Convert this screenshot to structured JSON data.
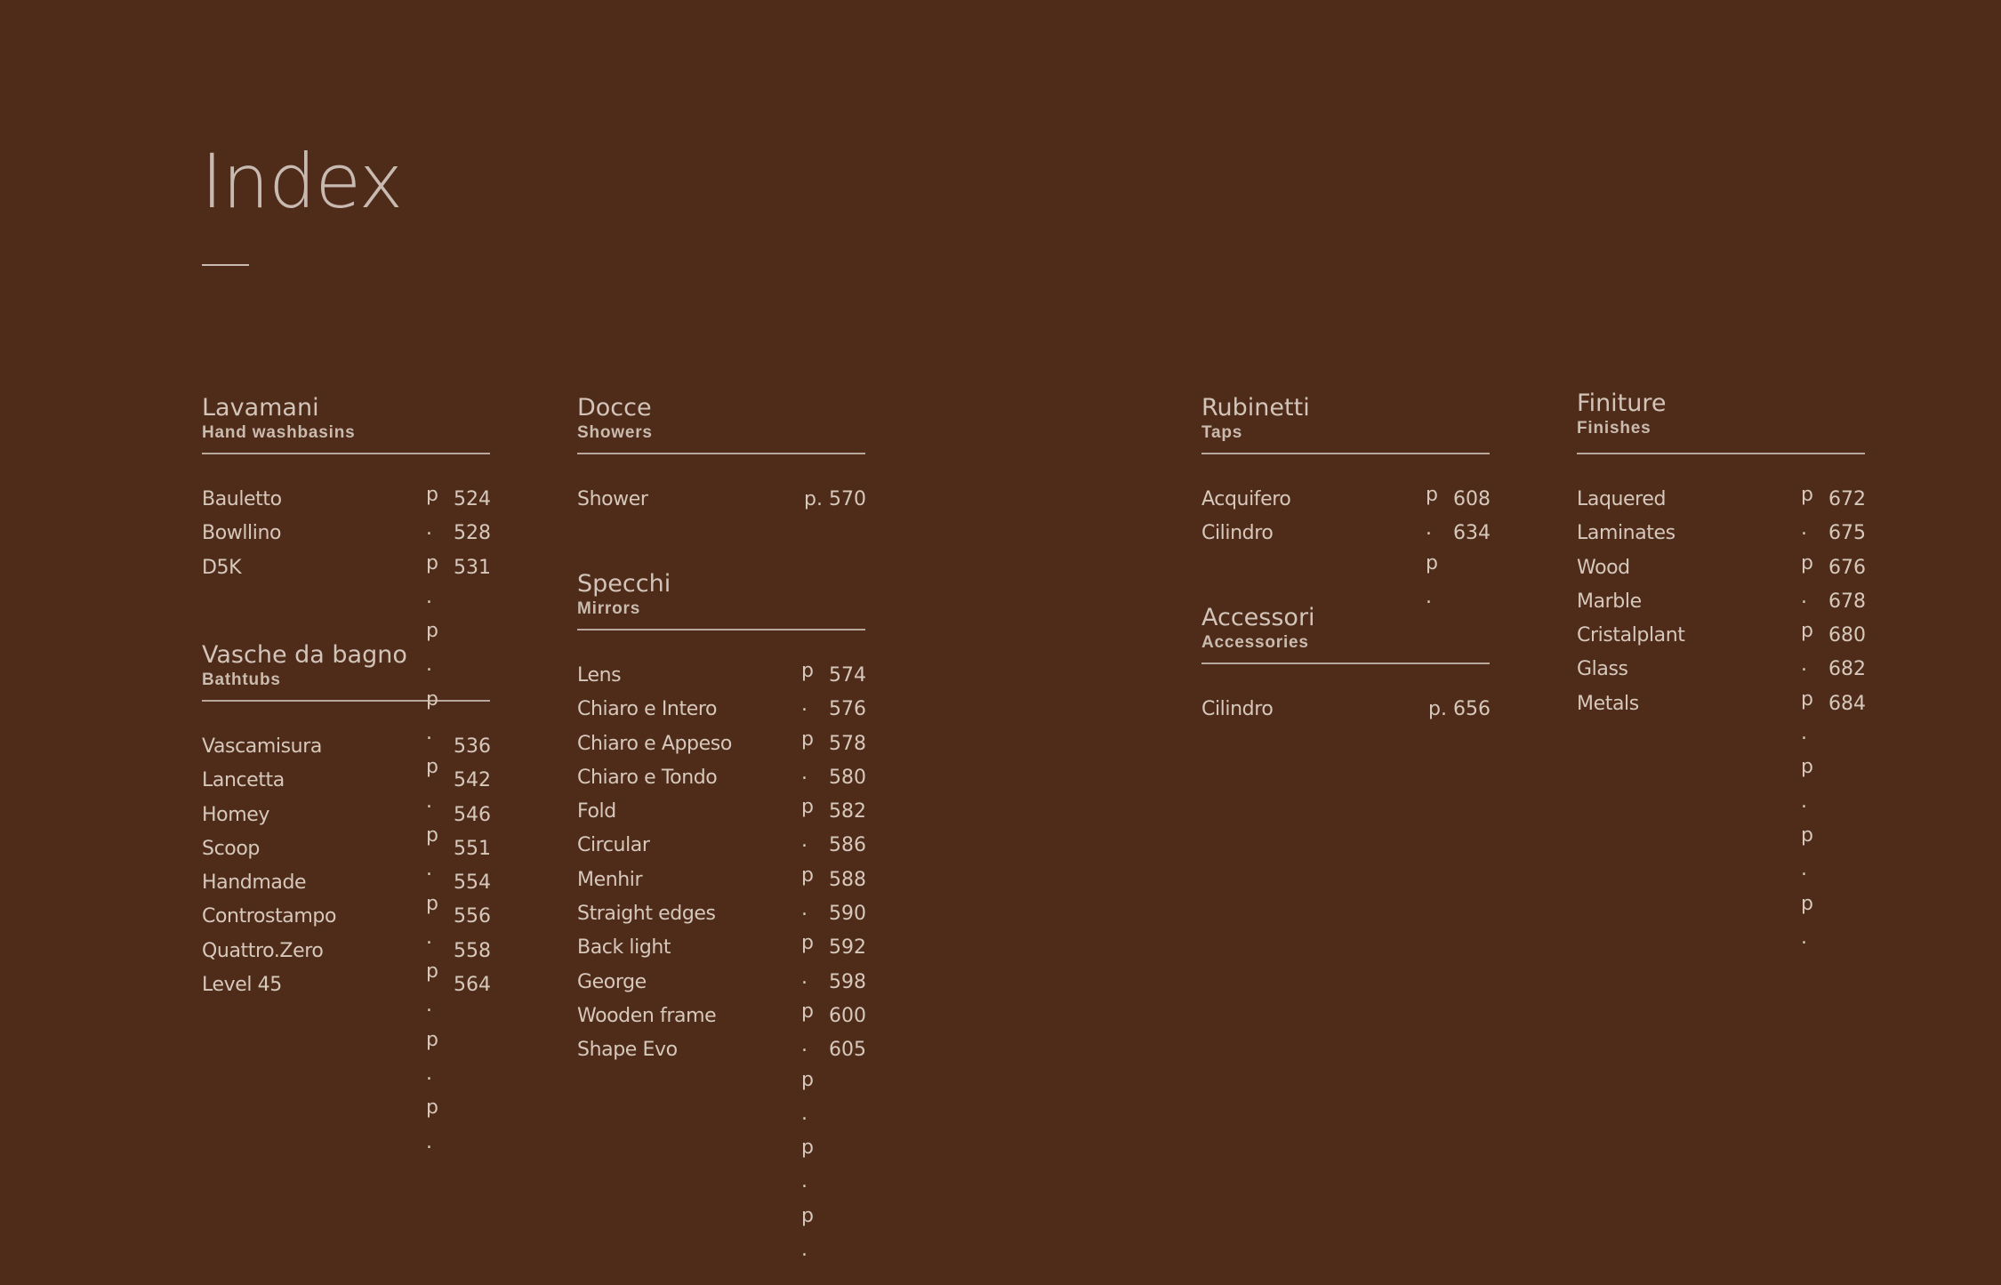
{
  "page": {
    "title": "Index",
    "p_marker": "p",
    "dot_marker": "."
  },
  "sections": {
    "lavamani": {
      "name": "Lavamani",
      "sub": "Hand washbasins",
      "entries": [
        {
          "label": "Bauletto",
          "page": "524"
        },
        {
          "label": "Bowllino",
          "page": "528"
        },
        {
          "label": "D5K",
          "page": "531"
        }
      ]
    },
    "vasche": {
      "name": "Vasche da bagno",
      "sub": "Bathtubs",
      "entries": [
        {
          "label": "Vascamisura",
          "page": "536"
        },
        {
          "label": "Lancetta",
          "page": "542"
        },
        {
          "label": "Homey",
          "page": "546"
        },
        {
          "label": "Scoop",
          "page": "551"
        },
        {
          "label": "Handmade",
          "page": "554"
        },
        {
          "label": "Controstampo",
          "page": "556"
        },
        {
          "label": "Quattro.Zero",
          "page": "558"
        },
        {
          "label": "Level 45",
          "page": "564"
        }
      ]
    },
    "docce": {
      "name": "Docce",
      "sub": "Showers",
      "entries": [
        {
          "label": "Shower",
          "page": "p.   570"
        }
      ]
    },
    "specchi": {
      "name": "Specchi",
      "sub": "Mirrors",
      "entries": [
        {
          "label": "Lens",
          "page": "574"
        },
        {
          "label": "Chiaro e Intero",
          "page": "576"
        },
        {
          "label": "Chiaro e Appeso",
          "page": "578"
        },
        {
          "label": "Chiaro e Tondo",
          "page": "580"
        },
        {
          "label": "Fold",
          "page": "582"
        },
        {
          "label": "Circular",
          "page": "586"
        },
        {
          "label": "Menhir",
          "page": "588"
        },
        {
          "label": "Straight edges",
          "page": "590"
        },
        {
          "label": "Back light",
          "page": "592"
        },
        {
          "label": "George",
          "page": "598"
        },
        {
          "label": "Wooden frame",
          "page": "600"
        },
        {
          "label": "Shape Evo",
          "page": "605"
        }
      ]
    },
    "rubinetti": {
      "name": "Rubinetti",
      "sub": "Taps",
      "entries": [
        {
          "label": "Acquifero",
          "page": "608"
        },
        {
          "label": "Cilindro",
          "page": "634"
        }
      ]
    },
    "accessori": {
      "name": "Accessori",
      "sub": "Accessories",
      "entries": [
        {
          "label": "Cilindro",
          "page": "p.   656"
        }
      ]
    },
    "finiture": {
      "name": "Finiture",
      "sub": "Finishes",
      "entries": [
        {
          "label": "Laquered",
          "page": "672"
        },
        {
          "label": "Laminates",
          "page": "675"
        },
        {
          "label": "Wood",
          "page": "676"
        },
        {
          "label": "Marble",
          "page": "678"
        },
        {
          "label": "Cristalplant",
          "page": "680"
        },
        {
          "label": "Glass",
          "page": "682"
        },
        {
          "label": "Metals",
          "page": "684"
        }
      ]
    }
  }
}
